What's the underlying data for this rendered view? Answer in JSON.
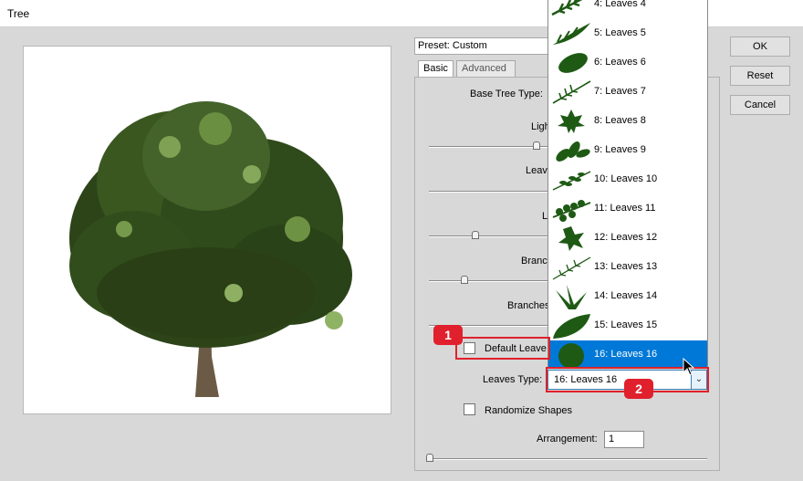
{
  "window": {
    "title": "Tree"
  },
  "preset": {
    "label": "Preset: Custom"
  },
  "tabs": [
    {
      "label": "Basic"
    },
    {
      "label": "Advanced"
    }
  ],
  "basic": {
    "base_tree_type_label": "Base Tree Type:",
    "light_label": "Ligh",
    "leaves_label": "Leave",
    "leaves_size_label": "Le",
    "branch_label": "Branch",
    "branches_label": "Branches",
    "default_leaves_label": "Default Leave",
    "leaves_type_label": "Leaves Type:",
    "leaves_type_value": "16: Leaves 16",
    "randomize_label": "Randomize Shapes",
    "arrangement_label": "Arrangement:",
    "arrangement_value": "1"
  },
  "sliders": [
    {
      "name": "light",
      "value": 0.4
    },
    {
      "name": "leaves-amount",
      "value": 0.6
    },
    {
      "name": "leaves-size",
      "value": 0.17
    },
    {
      "name": "branch-height",
      "value": 0.13
    },
    {
      "name": "branches-thickness",
      "value": 0.0
    },
    {
      "name": "arrangement",
      "value": 0.0
    }
  ],
  "buttons": {
    "ok": "OK",
    "reset": "Reset",
    "cancel": "Cancel"
  },
  "dropdown": {
    "items": [
      {
        "label": "4: Leaves 4"
      },
      {
        "label": "5: Leaves 5"
      },
      {
        "label": "6: Leaves 6"
      },
      {
        "label": "7: Leaves 7"
      },
      {
        "label": "8: Leaves 8"
      },
      {
        "label": "9: Leaves 9"
      },
      {
        "label": "10: Leaves 10"
      },
      {
        "label": "11: Leaves 11"
      },
      {
        "label": "12: Leaves 12"
      },
      {
        "label": "13: Leaves 13"
      },
      {
        "label": "14: Leaves 14"
      },
      {
        "label": "15: Leaves 15"
      },
      {
        "label": "16: Leaves 16"
      }
    ],
    "selected_index": 12
  },
  "callouts": [
    {
      "number": "1"
    },
    {
      "number": "2"
    }
  ],
  "colors": {
    "accent": "#0078d7",
    "leaf": "#1e5a14",
    "callout": "#e0202c"
  }
}
